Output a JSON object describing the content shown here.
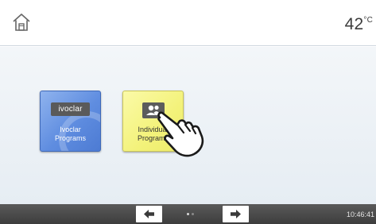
{
  "header": {
    "home_icon": "home-icon",
    "temperature_value": "42",
    "temperature_unit": "°C"
  },
  "tiles": [
    {
      "name": "ivoclar-programs",
      "logo_text": "ivoclar",
      "label_line1": "Ivoclar",
      "label_line2": "Programs",
      "color": "#6a95e3"
    },
    {
      "name": "individual-programs",
      "icon": "users-icon",
      "label_line1": "Individual",
      "label_line2": "Programs",
      "color": "#f3f27a"
    }
  ],
  "pointer": {
    "icon": "tap-hand-icon"
  },
  "footer": {
    "prev_icon": "arrow-left-icon",
    "next_icon": "arrow-right-icon",
    "page_count": 2,
    "current_page": 1,
    "clock": "10:46:41"
  }
}
